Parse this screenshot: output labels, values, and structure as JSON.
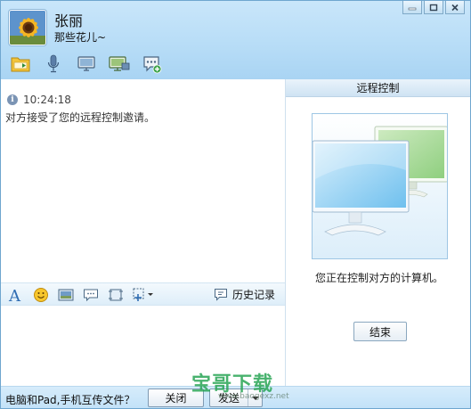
{
  "contact": {
    "name": "张丽",
    "signature": "那些花儿~"
  },
  "toolbar": {
    "items": [
      "folder-icon",
      "mic-icon",
      "screen-icon",
      "remote-desktop-icon",
      "more-apps-icon"
    ]
  },
  "chat": {
    "messages": [
      {
        "time": "10:24:18",
        "text": "对方接受了您的远程控制邀请。"
      }
    ]
  },
  "format_bar": {
    "history_label": "历史记录"
  },
  "remote_panel": {
    "title": "远程控制",
    "status": "您正在控制对方的计算机。",
    "end_label": "结束"
  },
  "footer": {
    "transfer_text": "电脑和Pad,手机互传文件？",
    "close_label": "关闭",
    "send_label": "发送"
  },
  "watermark": {
    "main": "宝哥下载",
    "sub": "www.baogexz.net"
  },
  "colors": {
    "header_bg": "#b8ddf7",
    "accent": "#6fa6cf",
    "watermark": "#28a555"
  }
}
